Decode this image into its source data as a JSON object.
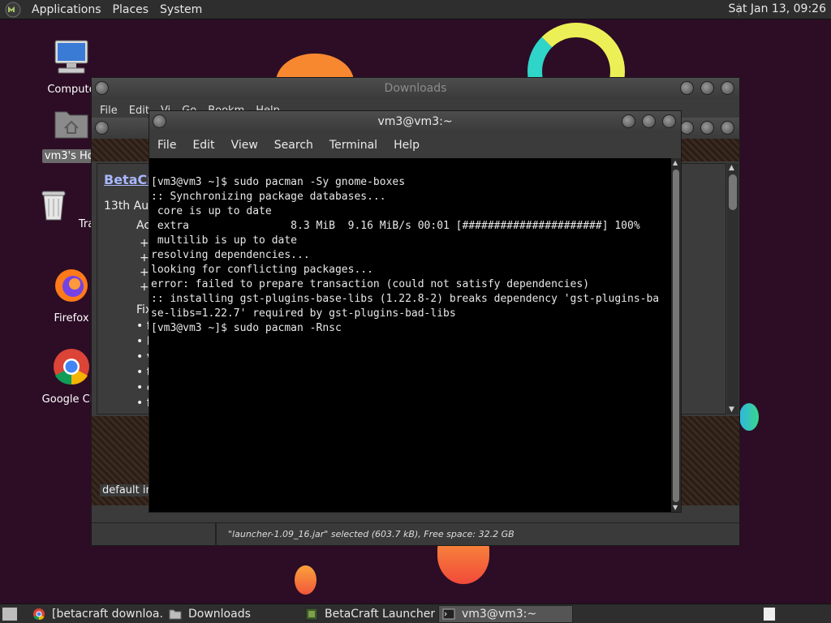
{
  "top_panel": {
    "menus": [
      "Applications",
      "Places",
      "System"
    ],
    "clock": "Sat Jan 13, 09:26"
  },
  "desktop_icons": [
    {
      "label": "Compute",
      "icon": "computer-icon"
    },
    {
      "label": "vm3's Hor",
      "icon": "home-folder-icon"
    },
    {
      "label": "Trash",
      "icon": "trash-icon"
    },
    {
      "label": "Firefox",
      "icon": "firefox-icon"
    },
    {
      "label": "Google Chr",
      "icon": "chrome-icon"
    }
  ],
  "downloads_window": {
    "title": "Downloads",
    "menu": [
      "File",
      "Edit",
      "Vi",
      "Go",
      "Bookm",
      "Help"
    ],
    "page": {
      "heading": "BetaCr",
      "date": "13th Aug",
      "lines": [
        "Ac",
        "+ (",
        "+ (",
        "+ l",
        "+ l",
        "Fix",
        "• fi",
        "• D",
        "• v",
        "• th",
        "• c",
        "• fi"
      ],
      "footer": "default ins"
    },
    "status": "\"launcher-1.09_16.jar\" selected (603.7 kB), Free space: 32.2 GB"
  },
  "terminal_window": {
    "title": "vm3@vm3:~",
    "menu": [
      "File",
      "Edit",
      "View",
      "Search",
      "Terminal",
      "Help"
    ],
    "lines": [
      "[vm3@vm3 ~]$ sudo pacman -Sy gnome-boxes",
      ":: Synchronizing package databases...",
      " core is up to date",
      " extra                8.3 MiB  9.16 MiB/s 00:01 [######################] 100%",
      " multilib is up to date",
      "resolving dependencies...",
      "looking for conflicting packages...",
      "error: failed to prepare transaction (could not satisfy dependencies)",
      ":: installing gst-plugins-base-libs (1.22.8-2) breaks dependency 'gst-plugins-ba",
      "se-libs=1.22.7' required by gst-plugins-bad-libs",
      "[vm3@vm3 ~]$ sudo pacman -Rnsc"
    ]
  },
  "taskbar": {
    "tasks": [
      {
        "label": "[betacraft downloa...",
        "icon": "chrome-icon"
      },
      {
        "label": "Downloads",
        "icon": "folder-icon"
      },
      {
        "label": "BetaCraft Launcher ...",
        "icon": "java-icon"
      },
      {
        "label": "vm3@vm3:~",
        "icon": "terminal-icon"
      }
    ]
  }
}
